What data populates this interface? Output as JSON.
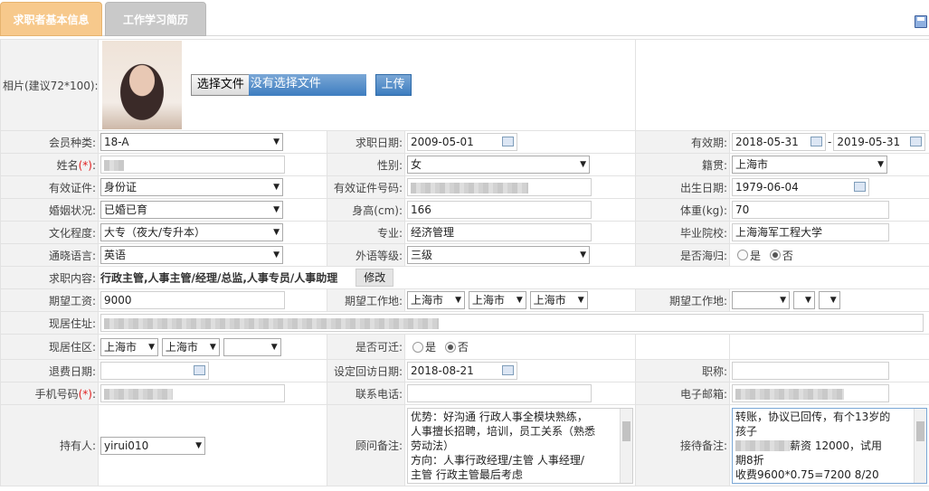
{
  "tabs": {
    "basic": "求职者基本信息",
    "history": "工作学习简历"
  },
  "photo": {
    "label": "相片(建议72*100):",
    "choose_label": "选择文件",
    "none_label": "没有选择文件",
    "upload_label": "上传"
  },
  "labels": {
    "member_type": "会员种类:",
    "apply_date": "求职日期:",
    "valid_period": "有效期:",
    "name": "姓名",
    "gender": "性别:",
    "native": "籍贯:",
    "id_type": "有效证件:",
    "id_no": "有效证件号码:",
    "birth": "出生日期:",
    "marital": "婚姻状况:",
    "height": "身高(cm):",
    "weight": "体重(kg):",
    "education": "文化程度:",
    "major": "专业:",
    "school": "毕业院校:",
    "language": "通晓语言:",
    "foreign_level": "外语等级:",
    "returnee": "是否海归:",
    "job_content": "求职内容:",
    "salary": "期望工资:",
    "work_place": "期望工作地:",
    "work_place2": "期望工作地:",
    "address": "现居住址:",
    "district": "现居住区:",
    "relocate": "是否可迁:",
    "refund_date": "退费日期:",
    "visit_date": "设定回访日期:",
    "title": "职称:",
    "mobile": "手机号码",
    "phone": "联系电话:",
    "email": "电子邮箱:",
    "holder": "持有人:",
    "consultant_note": "顾问备注:",
    "reception_note": "接待备注:",
    "req": "(*)",
    "colon": ":"
  },
  "values": {
    "member_type": "18-A",
    "apply_date": "2009-05-01",
    "valid_from": "2018-05-31",
    "valid_dash": "-",
    "valid_to": "2019-05-31",
    "gender": "女",
    "native": "上海市",
    "id_type": "身份证",
    "birth": "1979-06-04",
    "marital": "已婚已育",
    "height": "166",
    "weight": "70",
    "education": "大专（夜大/专升本）",
    "major": "经济管理",
    "school": "上海海军工程大学",
    "language": "英语",
    "foreign_level": "三级",
    "yes": "是",
    "no": "否",
    "job_content": "行政主管,人事主管/经理/总监,人事专员/人事助理",
    "modify": "修改",
    "salary": "9000",
    "wp1": "上海市",
    "wp2": "上海市",
    "wp3": "上海市",
    "district1": "上海市",
    "district2": "上海市",
    "visit_date": "2018-08-21",
    "holder": "yirui010"
  },
  "consultant_note_lines": [
    "优势：好沟通 行政人事全模块熟练，",
    "人事擅长招聘，培训，员工关系（熟悉",
    "劳动法）",
    "方向：人事行政经理/主管 人事经理/",
    "主管 行政主管最后考虑"
  ],
  "reception_note_lines": [
    "转账，协议已回传，有个13岁的",
    "孩子",
    "薪资 12000，试用",
    "期8折",
    "收费9600*0.75=7200 8/20"
  ]
}
